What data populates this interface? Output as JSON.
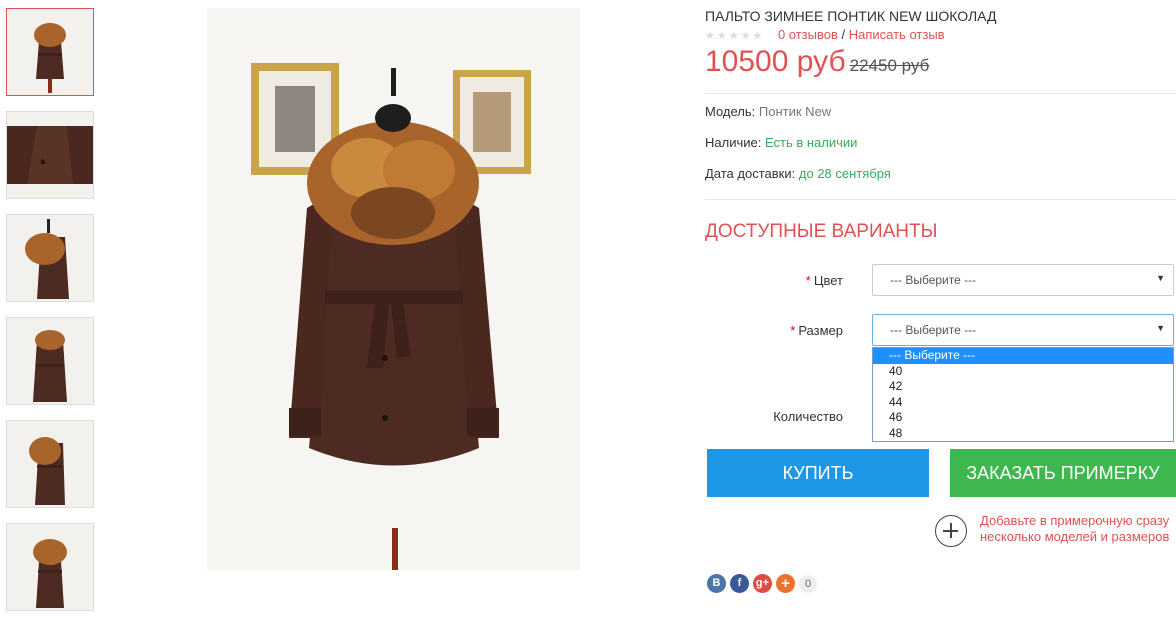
{
  "product": {
    "title": "ПАЛЬТО ЗИМНЕЕ ПОНТИК NEW ШОКОЛАД",
    "stars": "★★★★★",
    "reviews_link": "0 отзывов",
    "separator": "/",
    "write_review_link": "Написать отзыв",
    "price_new": "10500 руб",
    "price_old": "22450 руб"
  },
  "meta": {
    "model_label": "Модель:",
    "model_value": "Понтик New",
    "availability_label": "Наличие:",
    "availability_value": "Есть в наличии",
    "delivery_label": "Дата доставки:",
    "delivery_value": "до 28 сентября"
  },
  "options": {
    "title": "ДОСТУПНЫЕ ВАРИАНТЫ",
    "required_mark": "*",
    "color_label": "Цвет",
    "color_value": "--- Выберите ---",
    "size_label": "Размер",
    "size_value": "--- Выберите ---",
    "size_options": [
      "--- Выберите ---",
      "40",
      "42",
      "44",
      "46",
      "48"
    ],
    "quantity_label": "Количество"
  },
  "buttons": {
    "buy": "КУПИТЬ",
    "fitting": "ЗАКАЗАТЬ ПРИМЕРКУ"
  },
  "add_to_fitting": {
    "text": "Добавьте в примерочную сразу несколько моделей и размеров"
  },
  "social": {
    "vk": "В",
    "fb": "f",
    "gp": "g+",
    "share": "+",
    "count": "0"
  },
  "colors": {
    "accent": "#e05252",
    "green": "#3aaa5c",
    "buy_button": "#1e97e6",
    "fitting_button": "#3db74e",
    "coat": "#4e2b22",
    "fur": "#a8642a"
  }
}
